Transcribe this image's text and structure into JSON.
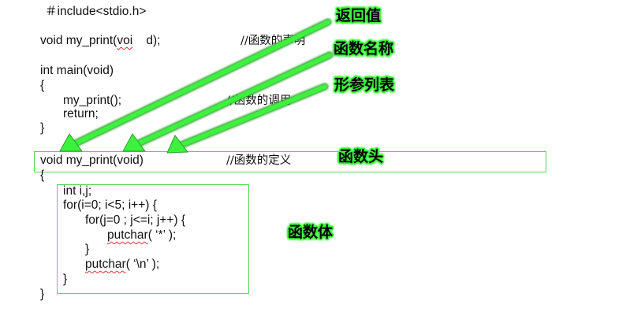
{
  "code": {
    "include_line": "＃include<stdio.h>",
    "decl_prefix": "void my_print(",
    "decl_voi": "voi",
    "decl_suffix": "    d);",
    "decl_comment": "//函数的声明",
    "main_sig": "int main(void)",
    "brace_open_1": "{",
    "call_line": "my_print();",
    "call_comment": "//函数的调用",
    "return_line": "return;",
    "brace_close_1": "}",
    "def_line": "void my_print(void)",
    "def_comment": "//函数的定义",
    "brace_open_2": "{",
    "body_decl": "int i,j;",
    "outer_for": "for(i=0; i<5; i++) {",
    "inner_for": "for(j=0 ; j<=i; j++) {",
    "putchar_1_fn": "putchar",
    "putchar_1_args": "( ‘*’ );",
    "inner_close": "}",
    "putchar_2_fn": "putchar",
    "putchar_2_args": "( ‘\\n’ );",
    "outer_close": "}",
    "brace_close_2": "}"
  },
  "labels": {
    "return_value": "返回值",
    "function_name": "函数名称",
    "parameter_list": "形参列表",
    "function_header": "函数头",
    "function_body": "函数体"
  },
  "colors": {
    "arrow": "#3df23d",
    "arrow_shadow": "#2a9e2a",
    "box_border": "#55d655",
    "squiggle": "#e03030"
  }
}
